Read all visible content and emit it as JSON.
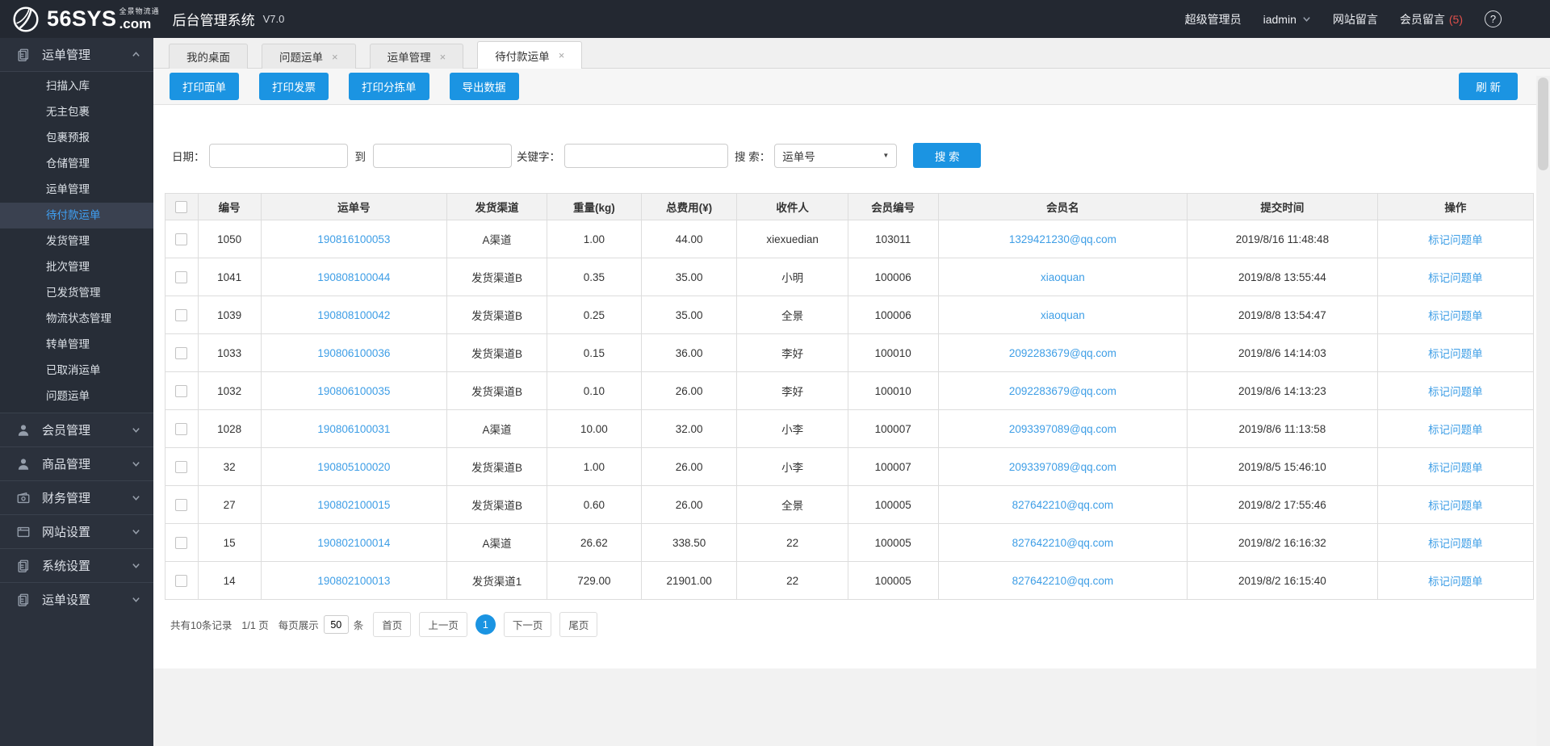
{
  "header": {
    "logo": {
      "main": "56SYS",
      "dot_com": ".com",
      "tagline": "全景物流通"
    },
    "app_title": "后台管理系统",
    "version": "V7.0",
    "role": "超级管理员",
    "username": "iadmin",
    "site_messages_label": "网站留言",
    "member_messages_label": "会员留言",
    "member_messages_badge": "(5)",
    "help_glyph": "?"
  },
  "sidebar": {
    "groups": [
      {
        "label": "运单管理",
        "icon": "document-icon",
        "expanded": true,
        "active_item": "待付款运单",
        "items": [
          "扫描入库",
          "无主包裹",
          "包裹预报",
          "仓储管理",
          "运单管理",
          "待付款运单",
          "发货管理",
          "批次管理",
          "已发货管理",
          "物流状态管理",
          "转单管理",
          "已取消运单",
          "问题运单"
        ]
      },
      {
        "label": "会员管理",
        "icon": "user-icon",
        "expanded": false
      },
      {
        "label": "商品管理",
        "icon": "user-icon",
        "expanded": false
      },
      {
        "label": "财务管理",
        "icon": "money-icon",
        "expanded": false
      },
      {
        "label": "网站设置",
        "icon": "browser-icon",
        "expanded": false
      },
      {
        "label": "系统设置",
        "icon": "document-icon",
        "expanded": false
      },
      {
        "label": "运单设置",
        "icon": "document-icon",
        "expanded": false
      }
    ]
  },
  "tabs": [
    {
      "label": "我的桌面",
      "closable": false,
      "active": false
    },
    {
      "label": "问题运单",
      "closable": true,
      "active": false
    },
    {
      "label": "运单管理",
      "closable": true,
      "active": false
    },
    {
      "label": "待付款运单",
      "closable": true,
      "active": true
    }
  ],
  "tab_close_glyph": "×",
  "toolbar": {
    "buttons": [
      "打印面单",
      "打印发票",
      "打印分拣单",
      "导出数据"
    ],
    "refresh_label": "刷 新"
  },
  "filters": {
    "date_label": "日期：",
    "to_label": "到",
    "keyword_label": "关键字：",
    "search_label": "搜 索：",
    "search_type_value": "运单号",
    "search_arrow": "▼",
    "search_button": "搜 索"
  },
  "table": {
    "columns": [
      "编号",
      "运单号",
      "发货渠道",
      "重量(kg)",
      "总费用(¥)",
      "收件人",
      "会员编号",
      "会员名",
      "提交时间",
      "操作"
    ],
    "action_label": "标记问题单",
    "rows": [
      {
        "id": "1050",
        "waybill": "190816100053",
        "channel": "A渠道",
        "weight": "1.00",
        "fee": "44.00",
        "recipient": "xiexuedian",
        "member_id": "103011",
        "member": "1329421230@qq.com",
        "time": "2019/8/16 11:48:48"
      },
      {
        "id": "1041",
        "waybill": "190808100044",
        "channel": "发货渠道B",
        "weight": "0.35",
        "fee": "35.00",
        "recipient": "小明",
        "member_id": "100006",
        "member": "xiaoquan",
        "time": "2019/8/8 13:55:44"
      },
      {
        "id": "1039",
        "waybill": "190808100042",
        "channel": "发货渠道B",
        "weight": "0.25",
        "fee": "35.00",
        "recipient": "全景",
        "member_id": "100006",
        "member": "xiaoquan",
        "time": "2019/8/8 13:54:47"
      },
      {
        "id": "1033",
        "waybill": "190806100036",
        "channel": "发货渠道B",
        "weight": "0.15",
        "fee": "36.00",
        "recipient": "李好",
        "member_id": "100010",
        "member": "2092283679@qq.com",
        "time": "2019/8/6 14:14:03"
      },
      {
        "id": "1032",
        "waybill": "190806100035",
        "channel": "发货渠道B",
        "weight": "0.10",
        "fee": "26.00",
        "recipient": "李好",
        "member_id": "100010",
        "member": "2092283679@qq.com",
        "time": "2019/8/6 14:13:23"
      },
      {
        "id": "1028",
        "waybill": "190806100031",
        "channel": "A渠道",
        "weight": "10.00",
        "fee": "32.00",
        "recipient": "小李",
        "member_id": "100007",
        "member": "2093397089@qq.com",
        "time": "2019/8/6 11:13:58"
      },
      {
        "id": "32",
        "waybill": "190805100020",
        "channel": "发货渠道B",
        "weight": "1.00",
        "fee": "26.00",
        "recipient": "小李",
        "member_id": "100007",
        "member": "2093397089@qq.com",
        "time": "2019/8/5 15:46:10"
      },
      {
        "id": "27",
        "waybill": "190802100015",
        "channel": "发货渠道B",
        "weight": "0.60",
        "fee": "26.00",
        "recipient": "全景",
        "member_id": "100005",
        "member": "827642210@qq.com",
        "time": "2019/8/2 17:55:46"
      },
      {
        "id": "15",
        "waybill": "190802100014",
        "channel": "A渠道",
        "weight": "26.62",
        "fee": "338.50",
        "recipient": "22",
        "member_id": "100005",
        "member": "827642210@qq.com",
        "time": "2019/8/2 16:16:32"
      },
      {
        "id": "14",
        "waybill": "190802100013",
        "channel": "发货渠道1",
        "weight": "729.00",
        "fee": "21901.00",
        "recipient": "22",
        "member_id": "100005",
        "member": "827642210@qq.com",
        "time": "2019/8/2 16:15:40"
      }
    ]
  },
  "pagination": {
    "summary": "共有10条记录",
    "page_info": "1/1 页",
    "per_page_label": "每页展示",
    "per_page_value": "50",
    "per_page_unit": "条",
    "first": "首页",
    "prev": "上一页",
    "current": "1",
    "next": "下一页",
    "last": "尾页"
  },
  "colors": {
    "accent_blue": "#1b94e2",
    "link_blue": "#3e9ee6",
    "badge_red": "#e2504b",
    "header_bg": "#232831",
    "sidebar_bg": "#2b313c",
    "active_item_text": "#3f9ff2"
  }
}
